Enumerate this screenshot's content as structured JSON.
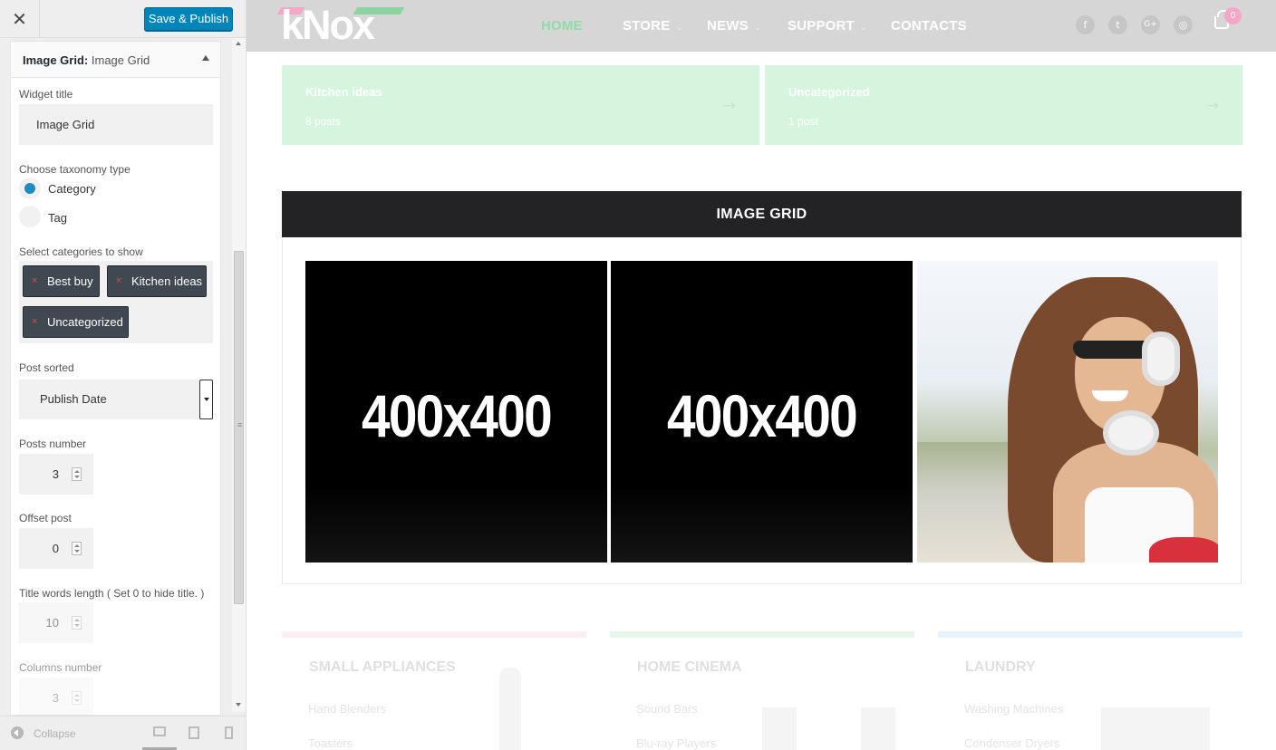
{
  "customizer": {
    "close_symbol": "✕",
    "save_label": "Save & Publish",
    "widget": {
      "type": "Image Grid",
      "name": "Image Grid"
    },
    "fields": {
      "widget_title_label": "Widget title",
      "widget_title_value": "Image Grid",
      "taxonomy_label": "Choose taxonomy type",
      "taxonomy_options": [
        "Category",
        "Tag"
      ],
      "taxonomy_selected": "Category",
      "categories_label": "Select categories to show",
      "categories": [
        "Best buy",
        "Kitchen ideas",
        "Uncategorized"
      ],
      "remove_symbol": "×",
      "post_sorted_label": "Post sorted",
      "post_sorted_value": "Publish Date",
      "posts_number_label": "Posts number",
      "posts_number_value": "3",
      "offset_label": "Offset post",
      "offset_value": "0",
      "title_words_label": "Title words length ( Set 0 to hide title. )",
      "title_words_value": "10",
      "columns_label": "Columns number",
      "columns_value": "3"
    },
    "footer": {
      "collapse_label": "Collapse",
      "devices": [
        "desktop",
        "tablet",
        "mobile"
      ],
      "active_device": "desktop"
    }
  },
  "preview": {
    "logo": "kNox",
    "nav": [
      {
        "label": "HOME",
        "active": true,
        "dropdown": false
      },
      {
        "label": "STORE",
        "active": false,
        "dropdown": true
      },
      {
        "label": "NEWS",
        "active": false,
        "dropdown": true
      },
      {
        "label": "SUPPORT",
        "active": false,
        "dropdown": true
      },
      {
        "label": "CONTACTS",
        "active": false,
        "dropdown": false
      }
    ],
    "dropdown_symbol": "⌄",
    "social": [
      {
        "icon": "facebook-icon",
        "glyph": "f"
      },
      {
        "icon": "twitter-icon",
        "glyph": "t"
      },
      {
        "icon": "google-plus-icon",
        "glyph": "G+"
      },
      {
        "icon": "instagram-icon",
        "glyph": "◎"
      }
    ],
    "cart_count": "0",
    "category_cards": [
      {
        "title": "Kitchen ideas",
        "count": "8 posts"
      },
      {
        "title": "Uncategorized",
        "count": "1 post"
      }
    ],
    "arrow_symbol": "→",
    "grid_title": "IMAGE GRID",
    "grid_tiles": [
      "400x400",
      "400x400"
    ],
    "photo_description_icon": "woman-with-headphones-photo",
    "bottom_sections": [
      {
        "title": "SMALL APPLIANCES",
        "items": [
          "Hand Blenders",
          "Toasters"
        ],
        "accent": "#f4a8c6"
      },
      {
        "title": "HOME CINEMA",
        "items": [
          "Sound Bars",
          "Blu-ray Players"
        ],
        "accent": "#8cd39f"
      },
      {
        "title": "LAUNDRY",
        "items": [
          "Washing Machines",
          "Condenser Dryers"
        ],
        "accent": "#8cc8f0"
      }
    ]
  },
  "colors": {
    "publish_button": "#0085ba",
    "nav_active": "#90dba8",
    "nav_bar": "#d6d6d6",
    "category_card": "#d6f5df",
    "grid_header": "#232224",
    "radio_selected": "#1e8cbe",
    "chip": "#404952"
  }
}
